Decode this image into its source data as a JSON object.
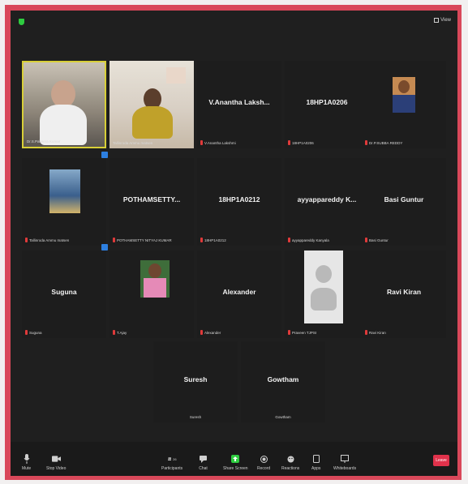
{
  "top": {
    "view_label": "View"
  },
  "tiles": {
    "t1_label": "Dr.S.Pakeera Kumar",
    "t2_label": "Tallinroda Ammu matsen",
    "t3_name": "V.Anantha Laksh...",
    "t3_label": "V.Anantha Lakshmi",
    "t4_name": "18HP1A0206",
    "t4_label": "18HP1A0206",
    "t5_label": "Dr.P.SUBBA REDDY",
    "t6_label": "Tallinroda Ammu matsen",
    "t7_name": "POTHAMSETTY...",
    "t7_label": "POTHAMSETTY NITYAJ KUMAR",
    "t8_name": "18HP1A0212",
    "t8_label": "18HP1A0212",
    "t9_name": "ayyappareddy K...",
    "t9_label": "ayyappareddy Kanyala",
    "t10_name": "Basi Guntur",
    "t10_label": "Basi Guntur",
    "t11_name": "Suguna",
    "t11_label": "Suguna",
    "t12_label": "T.Ajay",
    "t13_name": "Alexander",
    "t13_label": "Alexander",
    "t14_label": "Praveen TJPSI",
    "t15_name": "Ravi Kiran",
    "t15_label": "Ravi Kiran",
    "t16_name": "Suresh",
    "t16_label": "Suresh",
    "t17_name": "Gowtham",
    "t17_label": "Gowtham"
  },
  "toolbar": {
    "mute": "Mute",
    "stop_video": "Stop Video",
    "participants": "Participants",
    "participants_count": "26",
    "chat": "Chat",
    "share_screen": "Share Screen",
    "record": "Record",
    "reactions": "Reactions",
    "apps": "Apps",
    "whiteboards": "Whiteboards",
    "leave": "Leave"
  },
  "colors": {
    "frame": "#d9485a",
    "active_speaker": "#d8cf38",
    "share": "#2ecc40",
    "leave": "#e0324b"
  }
}
